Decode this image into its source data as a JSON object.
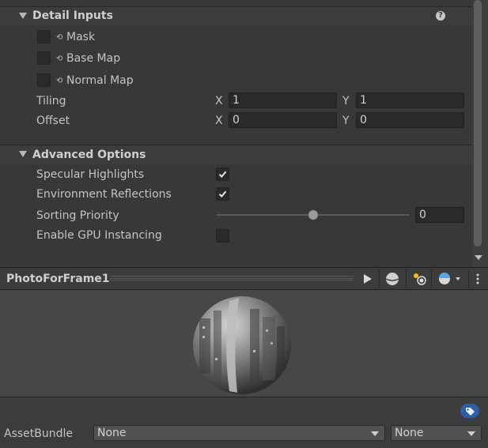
{
  "detail_inputs": {
    "title": "Detail Inputs",
    "help_icon": "help-icon",
    "textures": [
      {
        "label": "Mask"
      },
      {
        "label": "Base Map"
      },
      {
        "label": "Normal Map"
      }
    ],
    "tiling": {
      "label": "Tiling",
      "x_label": "X",
      "x_value": "1",
      "y_label": "Y",
      "y_value": "1"
    },
    "offset": {
      "label": "Offset",
      "x_label": "X",
      "x_value": "0",
      "y_label": "Y",
      "y_value": "0"
    }
  },
  "advanced_options": {
    "title": "Advanced Options",
    "specular_highlights": {
      "label": "Specular Highlights",
      "checked": true
    },
    "environment_reflections": {
      "label": "Environment Reflections",
      "checked": true
    },
    "sorting_priority": {
      "label": "Sorting Priority",
      "value": "0",
      "slider_fraction": 0.5
    },
    "gpu_instancing": {
      "label": "Enable GPU Instancing",
      "checked": false
    }
  },
  "preview": {
    "title": "PhotoForFrame1",
    "tools": [
      "play-icon",
      "sphere-shape-icon",
      "light-icon",
      "skybox-icon",
      "kebab-menu-icon"
    ]
  },
  "asset_bundle": {
    "tag_icon": "tag-icon",
    "label": "AssetBundle",
    "name_value": "None",
    "variant_value": "None"
  },
  "colors": {
    "background": "#383838",
    "field": "#2a2a2a",
    "tag_badge": "#2d5ea8"
  }
}
